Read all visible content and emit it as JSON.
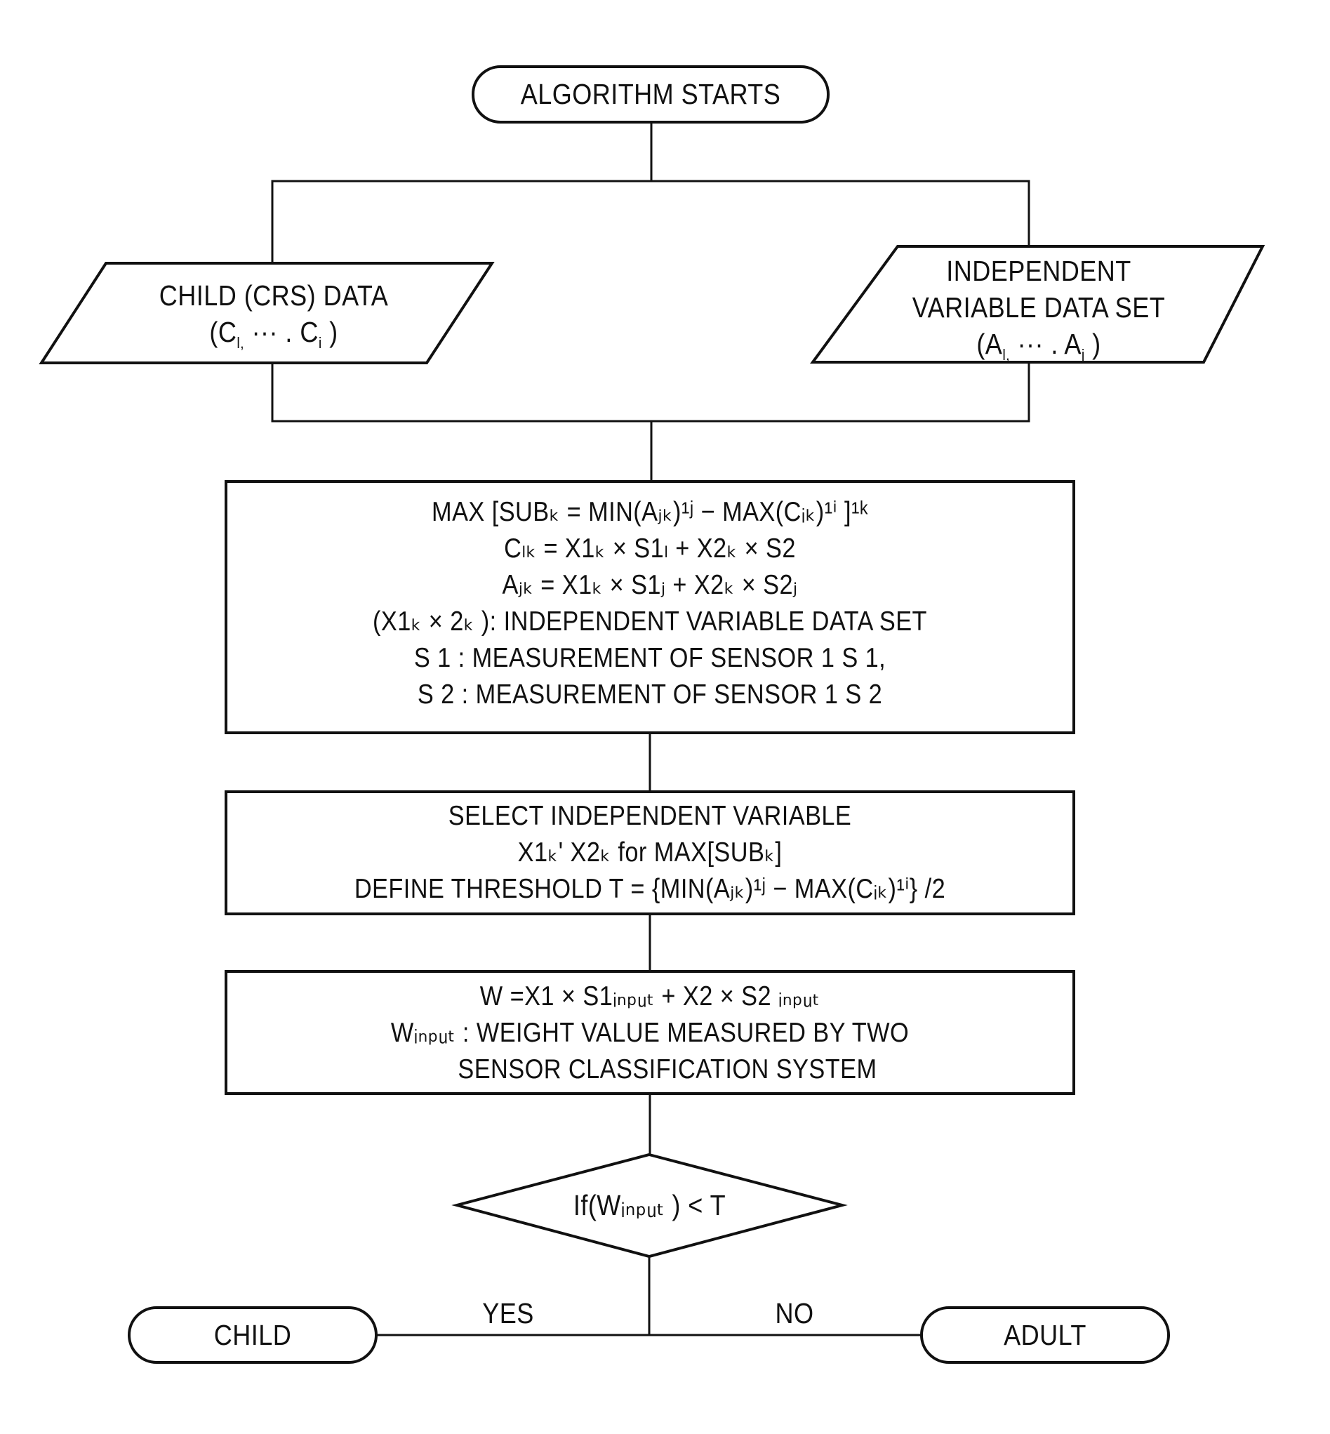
{
  "colors": {
    "stroke": "#111111",
    "background": "#ffffff"
  },
  "start": {
    "label": "ALGORITHM STARTS"
  },
  "child_data": {
    "line1": "CHILD (CRS) DATA",
    "line2_pre": "(C",
    "line2_sub1": "l,",
    "line2_mid": " ··· . C",
    "line2_sub2": "i",
    "line2_post": " )"
  },
  "independent_data": {
    "line1": "INDEPENDENT",
    "line2": "VARIABLE DATA SET",
    "line3_pre": "(A",
    "line3_sub1": "l,",
    "line3_mid": " ··· . A",
    "line3_sub2": "j",
    "line3_post": " )"
  },
  "box1": {
    "lines": [
      "MAX [SUBₖ = MIN(Aⱼₖ)¹ʲ − MAX(Cᵢₖ)¹ⁱ ]¹ᵏ",
      "Cₗₖ = X1ₖ × S1ₗ + X2ₖ × S2",
      "Aⱼₖ = X1ₖ × S1ⱼ + X2ₖ × S2ⱼ",
      "(X1ₖ × 2ₖ ): INDEPENDENT VARIABLE DATA SET",
      "S 1 : MEASUREMENT OF SENSOR 1 S 1,",
      "S 2 : MEASUREMENT OF SENSOR 1 S 2"
    ]
  },
  "box2": {
    "lines": [
      "SELECT INDEPENDENT VARIABLE",
      "X1ₖ' X2ₖ for MAX[SUBₖ]",
      "DEFINE THRESHOLD  T  = {MIN(Aⱼₖ)¹ʲ − MAX(Cᵢₖ)¹ⁱ} /2"
    ]
  },
  "box3": {
    "lines": [
      "W     =X1 × S1ᵢₙₚᵤₜ + X2 × S2 ᵢₙₚᵤₜ",
      "Wᵢₙₚᵤₜ : WEIGHT VALUE MEASURED BY TWO",
      "     SENSOR CLASSIFICATION SYSTEM"
    ]
  },
  "decision": {
    "label": "If(Wᵢₙₚᵤₜ ) < T"
  },
  "branches": {
    "yes": "YES",
    "no": "NO"
  },
  "outcomes": {
    "child": "CHILD",
    "adult": "ADULT"
  }
}
